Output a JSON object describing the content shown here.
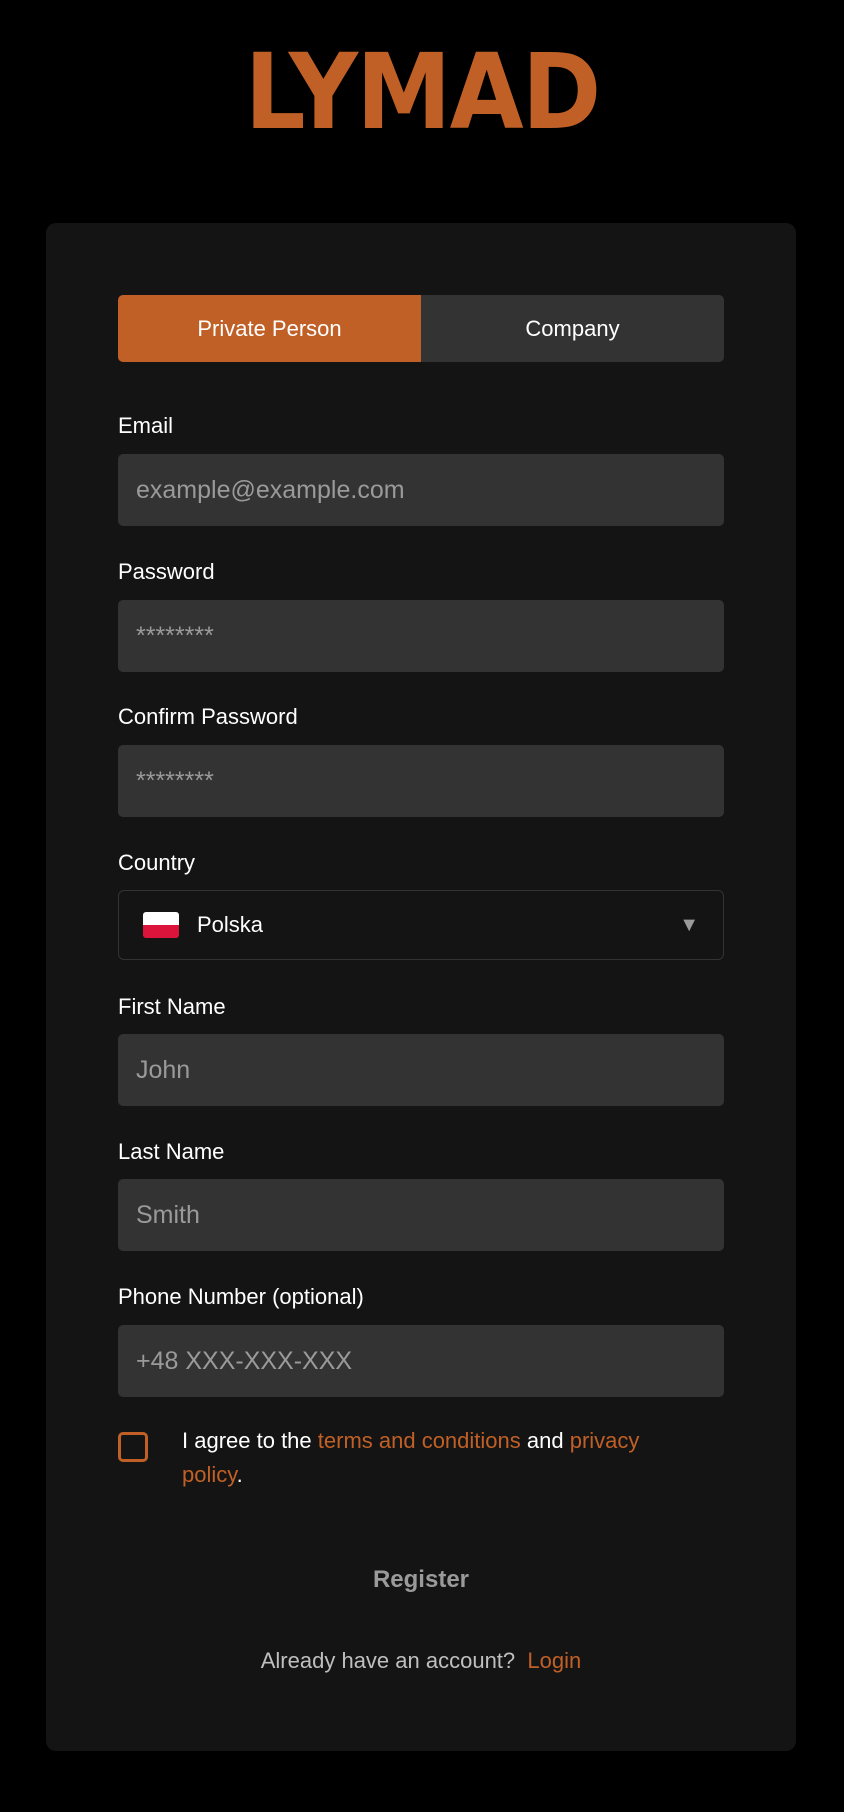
{
  "brand": {
    "logo_text": "LYMAD"
  },
  "colors": {
    "accent": "#c06026",
    "background": "#000000",
    "card": "#141414",
    "input": "#333333"
  },
  "tabs": [
    {
      "label": "Private Person",
      "active": true
    },
    {
      "label": "Company",
      "active": false
    }
  ],
  "form": {
    "email": {
      "label": "Email",
      "placeholder": "example@example.com"
    },
    "password": {
      "label": "Password",
      "placeholder": "********"
    },
    "confirm_password": {
      "label": "Confirm Password",
      "placeholder": "********"
    },
    "country": {
      "label": "Country",
      "value": "Polska",
      "flag_icon": "poland-flag-icon",
      "chevron_icon": "chevron-down-icon",
      "chevron_glyph": "▼"
    },
    "first_name": {
      "label": "First Name",
      "placeholder": "John"
    },
    "last_name": {
      "label": "Last Name",
      "placeholder": "Smith"
    },
    "phone": {
      "label": "Phone Number (optional)",
      "placeholder": "+48 XXX-XXX-XXX"
    }
  },
  "agreement": {
    "checked": false,
    "prefix": "I agree to the ",
    "terms_link": "terms and conditions",
    "middle": " and ",
    "privacy_link": "privacy policy",
    "suffix": "."
  },
  "register_label": "Register",
  "login_prompt": {
    "text": "Already have an account?",
    "link": "Login"
  }
}
